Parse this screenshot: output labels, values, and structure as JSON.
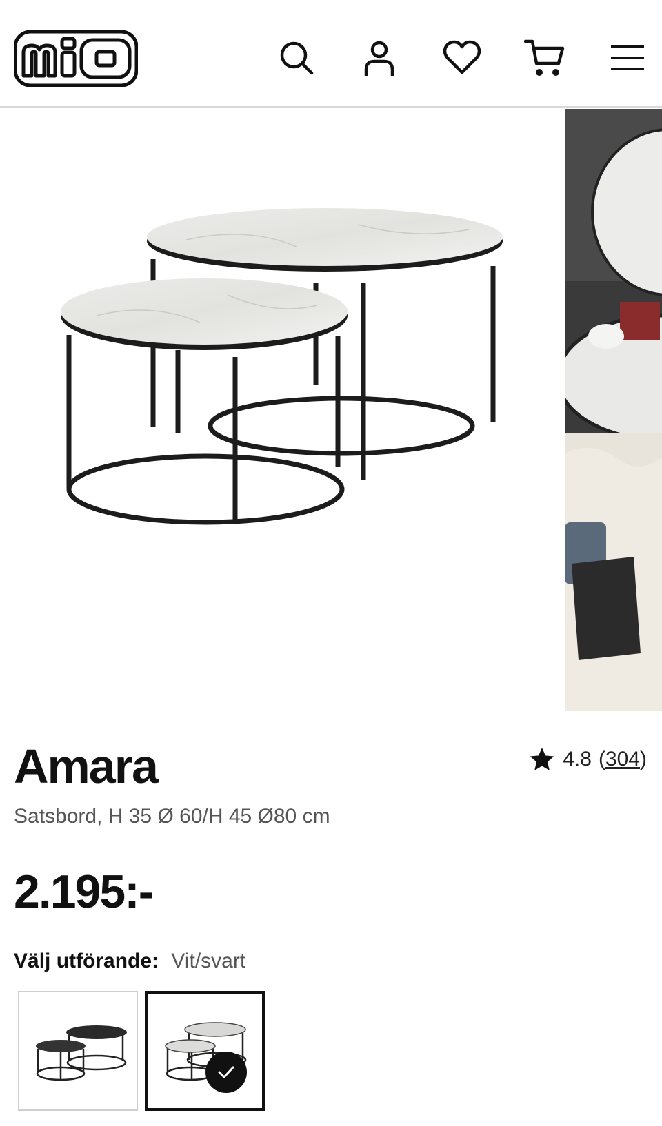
{
  "header": {
    "logo_text": "mio",
    "icons": [
      "search-icon",
      "account-icon",
      "heart-icon",
      "cart-icon",
      "menu-icon"
    ]
  },
  "product": {
    "name": "Amara",
    "description": "Satsbord, H 35 Ø 60/H 45 Ø80 cm",
    "price": "2.195:-",
    "rating": {
      "score": "4.8",
      "open_paren": "(",
      "count": "304",
      "close_paren": ")"
    }
  },
  "variant": {
    "label": "Välj utförande:",
    "selected_value": "Vit/svart",
    "options": [
      {
        "name": "Svart/svart",
        "selected": false
      },
      {
        "name": "Vit/svart",
        "selected": true
      }
    ]
  },
  "colors": {
    "text": "#111111",
    "muted": "#555555",
    "divider": "#d9d9d9"
  }
}
